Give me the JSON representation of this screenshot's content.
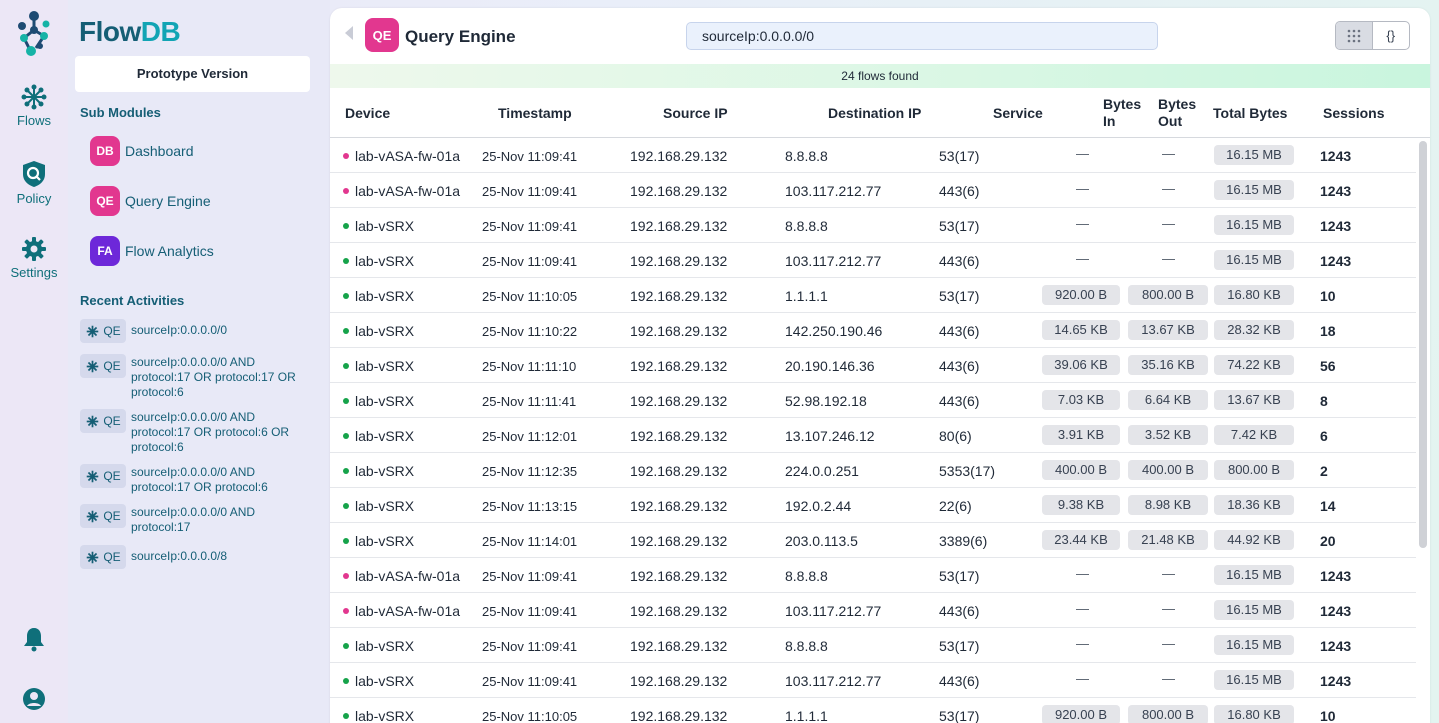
{
  "app": {
    "name_part1": "Flow",
    "name_part2": "DB",
    "version_label": "Prototype Version"
  },
  "rail": {
    "items": [
      {
        "label": "Flows",
        "icon": "flows-icon"
      },
      {
        "label": "Policy",
        "icon": "policy-icon"
      },
      {
        "label": "Settings",
        "icon": "gear-icon"
      }
    ]
  },
  "sidebar": {
    "submodules_title": "Sub Modules",
    "submodules": [
      {
        "abbr": "DB",
        "label": "Dashboard",
        "color": "#e2378f"
      },
      {
        "abbr": "QE",
        "label": "Query Engine",
        "color": "#e2378f"
      },
      {
        "abbr": "FA",
        "label": "Flow Analytics",
        "color": "#6d28d9"
      }
    ],
    "recent_title": "Recent Activities",
    "recent": [
      {
        "tag": "QE",
        "text": "sourceIp:0.0.0.0/0"
      },
      {
        "tag": "QE",
        "text": "sourceIp:0.0.0.0/0 AND protocol:17 OR protocol:17 OR protocol:6"
      },
      {
        "tag": "QE",
        "text": "sourceIp:0.0.0.0/0 AND protocol:17 OR protocol:6 OR protocol:6"
      },
      {
        "tag": "QE",
        "text": "sourceIp:0.0.0.0/0 AND protocol:17 OR protocol:6"
      },
      {
        "tag": "QE",
        "text": "sourceIp:0.0.0.0/0 AND protocol:17"
      },
      {
        "tag": "QE",
        "text": "sourceIp:0.0.0.0/8"
      }
    ]
  },
  "header": {
    "badge": "QE",
    "title": "Query Engine",
    "search_value": "sourceIp:0.0.0.0/0",
    "toggle_grid_icon": "grid-icon",
    "toggle_json_label": "{}"
  },
  "results": {
    "summary": "24 flows found"
  },
  "table": {
    "headers": {
      "device": "Device",
      "timestamp": "Timestamp",
      "source_ip": "Source IP",
      "destination_ip": "Destination IP",
      "service": "Service",
      "bytes_in_1": "Bytes",
      "bytes_in_2": "In",
      "bytes_out_1": "Bytes",
      "bytes_out_2": "Out",
      "total_bytes": "Total Bytes",
      "sessions": "Sessions"
    },
    "colors": {
      "asa": "#e2378f",
      "srx": "#16a34a"
    },
    "rows": [
      {
        "device": "lab-vASA-fw-01a",
        "kind": "asa",
        "ts": "25-Nov 11:09:41",
        "src": "192.168.29.132",
        "dst": "8.8.8.8",
        "svc": "53(17)",
        "in": "—",
        "out": "—",
        "total": "16.15 MB",
        "sessions": "1243"
      },
      {
        "device": "lab-vASA-fw-01a",
        "kind": "asa",
        "ts": "25-Nov 11:09:41",
        "src": "192.168.29.132",
        "dst": "103.117.212.77",
        "svc": "443(6)",
        "in": "—",
        "out": "—",
        "total": "16.15 MB",
        "sessions": "1243"
      },
      {
        "device": "lab-vSRX",
        "kind": "srx",
        "ts": "25-Nov 11:09:41",
        "src": "192.168.29.132",
        "dst": "8.8.8.8",
        "svc": "53(17)",
        "in": "—",
        "out": "—",
        "total": "16.15 MB",
        "sessions": "1243"
      },
      {
        "device": "lab-vSRX",
        "kind": "srx",
        "ts": "25-Nov 11:09:41",
        "src": "192.168.29.132",
        "dst": "103.117.212.77",
        "svc": "443(6)",
        "in": "—",
        "out": "—",
        "total": "16.15 MB",
        "sessions": "1243"
      },
      {
        "device": "lab-vSRX",
        "kind": "srx",
        "ts": "25-Nov 11:10:05",
        "src": "192.168.29.132",
        "dst": "1.1.1.1",
        "svc": "53(17)",
        "in": "920.00 B",
        "out": "800.00 B",
        "total": "16.80 KB",
        "sessions": "10"
      },
      {
        "device": "lab-vSRX",
        "kind": "srx",
        "ts": "25-Nov 11:10:22",
        "src": "192.168.29.132",
        "dst": "142.250.190.46",
        "svc": "443(6)",
        "in": "14.65 KB",
        "out": "13.67 KB",
        "total": "28.32 KB",
        "sessions": "18"
      },
      {
        "device": "lab-vSRX",
        "kind": "srx",
        "ts": "25-Nov 11:11:10",
        "src": "192.168.29.132",
        "dst": "20.190.146.36",
        "svc": "443(6)",
        "in": "39.06 KB",
        "out": "35.16 KB",
        "total": "74.22 KB",
        "sessions": "56"
      },
      {
        "device": "lab-vSRX",
        "kind": "srx",
        "ts": "25-Nov 11:11:41",
        "src": "192.168.29.132",
        "dst": "52.98.192.18",
        "svc": "443(6)",
        "in": "7.03 KB",
        "out": "6.64 KB",
        "total": "13.67 KB",
        "sessions": "8"
      },
      {
        "device": "lab-vSRX",
        "kind": "srx",
        "ts": "25-Nov 11:12:01",
        "src": "192.168.29.132",
        "dst": "13.107.246.12",
        "svc": "80(6)",
        "in": "3.91 KB",
        "out": "3.52 KB",
        "total": "7.42 KB",
        "sessions": "6"
      },
      {
        "device": "lab-vSRX",
        "kind": "srx",
        "ts": "25-Nov 11:12:35",
        "src": "192.168.29.132",
        "dst": "224.0.0.251",
        "svc": "5353(17)",
        "in": "400.00 B",
        "out": "400.00 B",
        "total": "800.00 B",
        "sessions": "2"
      },
      {
        "device": "lab-vSRX",
        "kind": "srx",
        "ts": "25-Nov 11:13:15",
        "src": "192.168.29.132",
        "dst": "192.0.2.44",
        "svc": "22(6)",
        "in": "9.38 KB",
        "out": "8.98 KB",
        "total": "18.36 KB",
        "sessions": "14"
      },
      {
        "device": "lab-vSRX",
        "kind": "srx",
        "ts": "25-Nov 11:14:01",
        "src": "192.168.29.132",
        "dst": "203.0.113.5",
        "svc": "3389(6)",
        "in": "23.44 KB",
        "out": "21.48 KB",
        "total": "44.92 KB",
        "sessions": "20"
      },
      {
        "device": "lab-vASA-fw-01a",
        "kind": "asa",
        "ts": "25-Nov 11:09:41",
        "src": "192.168.29.132",
        "dst": "8.8.8.8",
        "svc": "53(17)",
        "in": "—",
        "out": "—",
        "total": "16.15 MB",
        "sessions": "1243"
      },
      {
        "device": "lab-vASA-fw-01a",
        "kind": "asa",
        "ts": "25-Nov 11:09:41",
        "src": "192.168.29.132",
        "dst": "103.117.212.77",
        "svc": "443(6)",
        "in": "—",
        "out": "—",
        "total": "16.15 MB",
        "sessions": "1243"
      },
      {
        "device": "lab-vSRX",
        "kind": "srx",
        "ts": "25-Nov 11:09:41",
        "src": "192.168.29.132",
        "dst": "8.8.8.8",
        "svc": "53(17)",
        "in": "—",
        "out": "—",
        "total": "16.15 MB",
        "sessions": "1243"
      },
      {
        "device": "lab-vSRX",
        "kind": "srx",
        "ts": "25-Nov 11:09:41",
        "src": "192.168.29.132",
        "dst": "103.117.212.77",
        "svc": "443(6)",
        "in": "—",
        "out": "—",
        "total": "16.15 MB",
        "sessions": "1243"
      },
      {
        "device": "lab-vSRX",
        "kind": "srx",
        "ts": "25-Nov 11:10:05",
        "src": "192.168.29.132",
        "dst": "1.1.1.1",
        "svc": "53(17)",
        "in": "920.00 B",
        "out": "800.00 B",
        "total": "16.80 KB",
        "sessions": "10"
      }
    ]
  }
}
